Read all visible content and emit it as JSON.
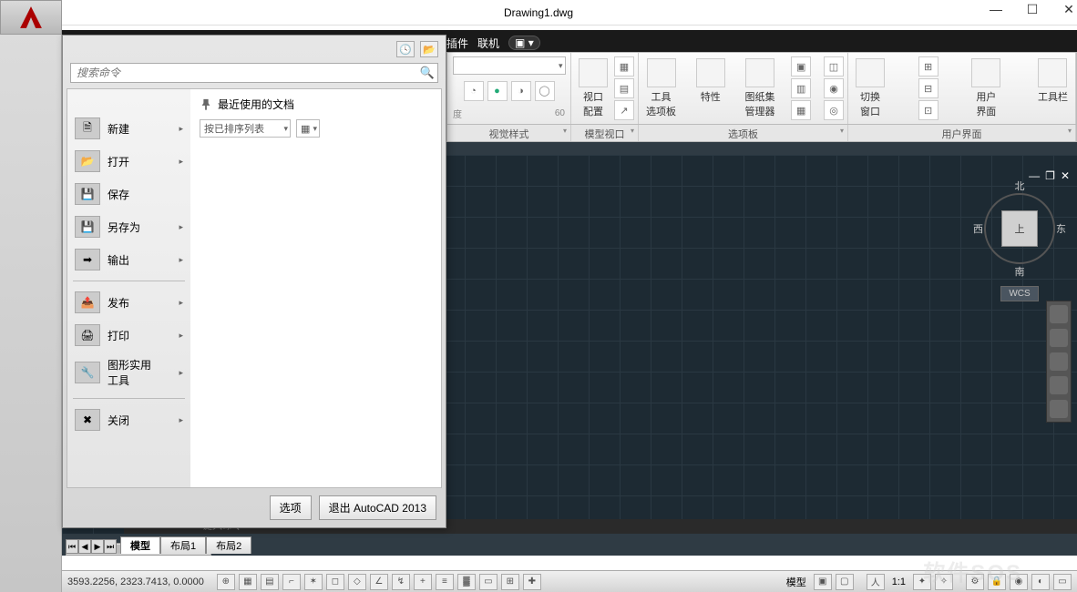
{
  "window": {
    "title": "Drawing1.dwg",
    "minimize": "—",
    "maximize": "☐",
    "close": "✕"
  },
  "ribbon": {
    "tabs": [
      "插件",
      "联机"
    ],
    "visual_style_label": "视觉样式",
    "model_vp_label": "模型视口",
    "panel_label": "选项板",
    "ui_label": "用户界面",
    "transparency_val": "60",
    "btn_viewport": "视口\n配置",
    "btn_tool_panel": "工具\n选项板",
    "btn_props": "特性",
    "btn_sheetset": "图纸集\n管理器",
    "btn_switch": "切换\n窗口",
    "btn_ui": "用户\n界面",
    "btn_toolbar": "工具栏"
  },
  "appmenu": {
    "search_ph": "搜索命令",
    "recent_label": "最近使用的文档",
    "sort_label": "按已排序列表",
    "items": {
      "new": "新建",
      "open": "打开",
      "save": "保存",
      "saveas": "另存为",
      "export": "输出",
      "publish": "发布",
      "print": "打印",
      "utils": "图形实用\n工具",
      "close": "关闭"
    },
    "options_btn": "选项",
    "exit_btn": "退出 AutoCAD 2013"
  },
  "canvas": {
    "north": "北",
    "south": "南",
    "east": "东",
    "west": "西",
    "top": "上",
    "wcs": "WCS"
  },
  "cmdline": {
    "ph": "键入命令"
  },
  "tabs": {
    "model": "模型",
    "layout1": "布局1",
    "layout2": "布局2"
  },
  "status": {
    "coords": "3593.2256, 2323.7413, 0.0000",
    "model": "模型",
    "scale": "1:1"
  },
  "watermark": "软件SOS"
}
